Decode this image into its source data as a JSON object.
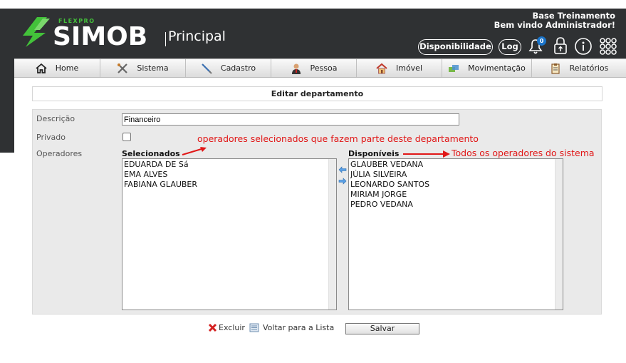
{
  "brand": {
    "small": "FLEXPRO",
    "big": "SIMOB",
    "sub": "Principal"
  },
  "user": {
    "line1": "Base Treinamento",
    "line2": "Bem vindo Administrador!"
  },
  "topbar": {
    "availability_label": "Disponibilidade",
    "log_label": "Log",
    "notifications_count": "0"
  },
  "nav": [
    {
      "label": "Home",
      "icon": "home-icon"
    },
    {
      "label": "Sistema",
      "icon": "tools-icon"
    },
    {
      "label": "Cadastro",
      "icon": "pen-icon"
    },
    {
      "label": "Pessoa",
      "icon": "person-icon"
    },
    {
      "label": "Imóvel",
      "icon": "house-icon"
    },
    {
      "label": "Movimentação",
      "icon": "transfer-icon"
    },
    {
      "label": "Relatórios",
      "icon": "report-icon"
    }
  ],
  "form": {
    "title": "Editar departamento",
    "description_label": "Descrição",
    "description_value": "Financeiro",
    "private_label": "Privado",
    "operators_label": "Operadores",
    "selected_header": "Selecionados",
    "available_header": "Disponíveis",
    "selected": [
      "EDUARDA DE Sá",
      "EMA ALVES",
      "FABIANA GLAUBER"
    ],
    "available": [
      "GLAUBER VEDANA",
      "JÚLIA SILVEIRA",
      "LEONARDO SANTOS",
      "MIRIAM JORGE",
      "PEDRO VEDANA"
    ]
  },
  "annotations": {
    "selected_note": "operadores selecionados que fazem parte deste departamento",
    "available_note": "Todos os operadores do sistema",
    "color": "#e11717"
  },
  "actions": {
    "delete_label": "Excluir",
    "back_label": "Voltar para a Lista",
    "save_label": "Salvar"
  },
  "colors": {
    "header_bg": "#2f3133",
    "brand_green": "#43c23a",
    "form_bg": "#eaeaea"
  }
}
